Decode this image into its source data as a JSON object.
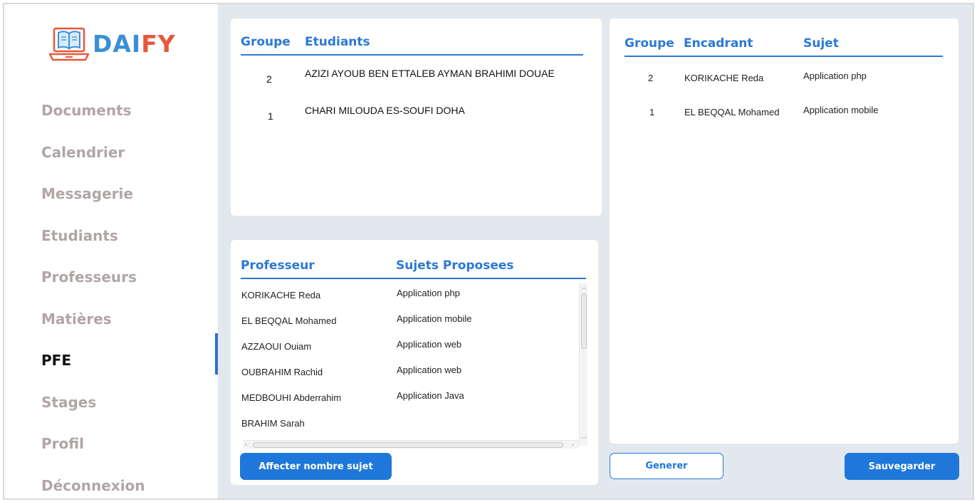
{
  "logo": {
    "part1": "DAI",
    "part2": "FY"
  },
  "sidebar": {
    "items": [
      {
        "label": "Documents"
      },
      {
        "label": "Calendrier"
      },
      {
        "label": "Messagerie"
      },
      {
        "label": "Etudiants"
      },
      {
        "label": "Professeurs"
      },
      {
        "label": "Matières"
      },
      {
        "label": "PFE"
      },
      {
        "label": "Stages"
      },
      {
        "label": "Profil"
      },
      {
        "label": "Déconnexion"
      }
    ],
    "active": "PFE"
  },
  "groups_panel": {
    "headers": {
      "groupe": "Groupe",
      "etudiants": "Etudiants"
    },
    "rows": [
      {
        "groupe": "2",
        "etudiants": "AZIZI AYOUB  BEN ETTALEB AYMAN  BRAHIMI DOUAE"
      },
      {
        "groupe": "1",
        "etudiants": "CHARI MILOUDA  ES-SOUFI DOHA"
      }
    ]
  },
  "professors_panel": {
    "headers": {
      "professeur": "Professeur",
      "sujets": "Sujets Proposees"
    },
    "rows": [
      {
        "professeur": "KORIKACHE Reda",
        "sujet": "Application php"
      },
      {
        "professeur": "EL BEQQAL Mohamed",
        "sujet": "Application mobile"
      },
      {
        "professeur": "AZZAOUI Ouiam",
        "sujet": "Application web"
      },
      {
        "professeur": "OUBRAHIM Rachid",
        "sujet": "Application web"
      },
      {
        "professeur": "MEDBOUHI Abderrahim",
        "sujet": "Application Java"
      },
      {
        "professeur": "BRAHIM Sarah",
        "sujet": ""
      }
    ],
    "button": "Affecter nombre sujet"
  },
  "assign_panel": {
    "headers": {
      "groupe": "Groupe",
      "encadrant": "Encadrant",
      "sujet": "Sujet"
    },
    "rows": [
      {
        "groupe": "2",
        "encadrant": "KORIKACHE Reda",
        "sujet": "Application php"
      },
      {
        "groupe": "1",
        "encadrant": "EL BEQQAL Mohamed",
        "sujet": "Application mobile"
      }
    ]
  },
  "actions": {
    "generer": "Generer",
    "sauvegarder": "Sauvegarder"
  },
  "colors": {
    "accent": "#2a78d6",
    "button": "#1f78d9",
    "logo_blue": "#3a8fd8",
    "logo_orange": "#e7573a",
    "background": "#e3e8ee",
    "active_bar": "#2d6fd6"
  }
}
